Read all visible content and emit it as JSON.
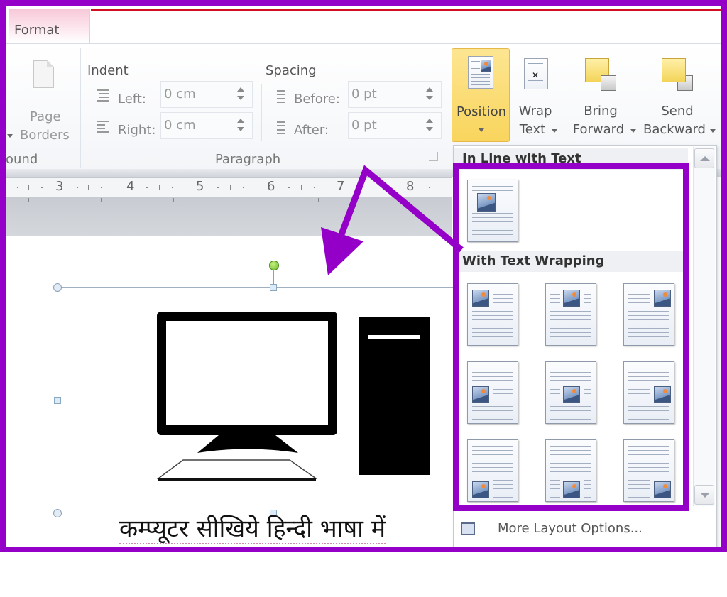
{
  "tabs": {
    "active": "Format"
  },
  "ribbon": {
    "page_background": {
      "page_borders_label_1": "Page",
      "page_borders_label_2": "Borders",
      "group_label": "ound"
    },
    "paragraph": {
      "group_label": "Paragraph",
      "indent": {
        "title": "Indent",
        "left_label": "Left:",
        "left_value": "0 cm",
        "right_label": "Right:",
        "right_value": "0 cm"
      },
      "spacing": {
        "title": "Spacing",
        "before_label": "Before:",
        "before_value": "0 pt",
        "after_label": "After:",
        "after_value": "0 pt"
      }
    },
    "arrange": {
      "position_label": "Position",
      "wrap_text_label_1": "Wrap",
      "wrap_text_label_2": "Text",
      "bring_forward_label_1": "Bring",
      "bring_forward_label_2": "Forward",
      "send_backward_label_1": "Send",
      "send_backward_label_2": "Backward"
    }
  },
  "ruler": {
    "numbers": [
      "3",
      "4",
      "5",
      "6",
      "7",
      "8"
    ]
  },
  "document": {
    "caption": "कम्प्यूटर सीखिये हिन्दी भाषा में"
  },
  "position_menu": {
    "inline_header": "In Line with Text",
    "wrapping_header": "With Text Wrapping",
    "wrapping_options": [
      "Top Left",
      "Top Center",
      "Top Right",
      "Middle Left",
      "Middle Center",
      "Middle Right",
      "Bottom Left",
      "Bottom Center",
      "Bottom Right"
    ],
    "more_options_label": "More Layout Options..."
  },
  "colors": {
    "annotation": "#9400c8",
    "position_button": "#f9d55d",
    "tab_accent": "#d01020"
  }
}
